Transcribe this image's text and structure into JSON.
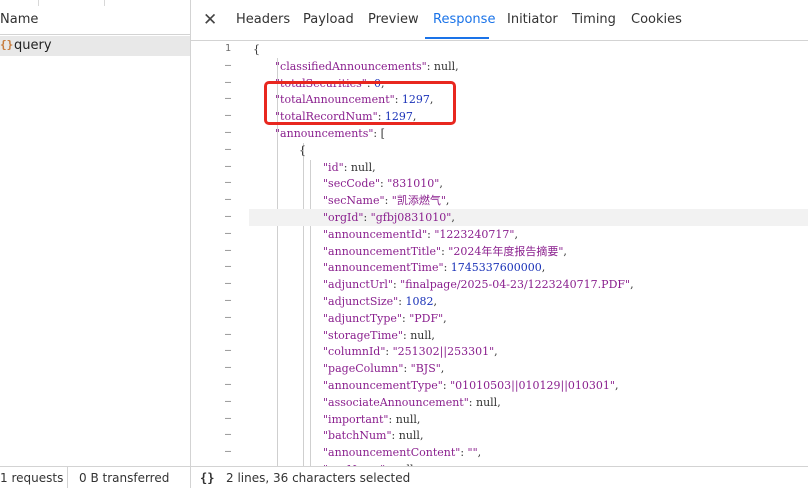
{
  "left": {
    "header": "Name",
    "request": {
      "icon": "json-braces-icon",
      "name": "query"
    }
  },
  "tabs": [
    "Headers",
    "Payload",
    "Preview",
    "Response",
    "Initiator",
    "Timing",
    "Cookies"
  ],
  "active_tab": "Response",
  "code": {
    "lines": [
      {
        "g": "1",
        "text": "{"
      },
      {
        "g": "–",
        "key": "classifiedAnnouncements",
        "val": "null",
        "vt": "p",
        "indent": 1
      },
      {
        "g": "–",
        "key": "totalSecurities",
        "val": "0",
        "vt": "n",
        "indent": 1
      },
      {
        "g": "–",
        "key": "totalAnnouncement",
        "val": "1297",
        "vt": "n",
        "indent": 1
      },
      {
        "g": "–",
        "key": "totalRecordNum",
        "val": "1297",
        "vt": "n",
        "indent": 1
      },
      {
        "g": "–",
        "key": "announcements",
        "val": "[",
        "vt": "p",
        "indent": 1,
        "noComma": true
      },
      {
        "g": "–",
        "text": "{",
        "indent": 2
      },
      {
        "g": "–",
        "key": "id",
        "val": "null",
        "vt": "p",
        "indent": 3
      },
      {
        "g": "–",
        "key": "secCode",
        "val": "\"831010\"",
        "vt": "s",
        "indent": 3
      },
      {
        "g": "–",
        "key": "secName",
        "val": "\"凯添燃气\"",
        "vt": "s",
        "indent": 3
      },
      {
        "g": "–",
        "key": "orgId",
        "val": "\"gfbj0831010\"",
        "vt": "s",
        "indent": 3,
        "hl": true
      },
      {
        "g": "–",
        "key": "announcementId",
        "val": "\"1223240717\"",
        "vt": "s",
        "indent": 3
      },
      {
        "g": "–",
        "key": "announcementTitle",
        "val": "\"2024年年度报告摘要\"",
        "vt": "s",
        "indent": 3
      },
      {
        "g": "–",
        "key": "announcementTime",
        "val": "1745337600000",
        "vt": "n",
        "indent": 3
      },
      {
        "g": "–",
        "key": "adjunctUrl",
        "val": "\"finalpage/2025-04-23/1223240717.PDF\"",
        "vt": "s",
        "indent": 3
      },
      {
        "g": "–",
        "key": "adjunctSize",
        "val": "1082",
        "vt": "n",
        "indent": 3
      },
      {
        "g": "–",
        "key": "adjunctType",
        "val": "\"PDF\"",
        "vt": "s",
        "indent": 3
      },
      {
        "g": "–",
        "key": "storageTime",
        "val": "null",
        "vt": "p",
        "indent": 3
      },
      {
        "g": "–",
        "key": "columnId",
        "val": "\"251302||253301\"",
        "vt": "s",
        "indent": 3
      },
      {
        "g": "–",
        "key": "pageColumn",
        "val": "\"BJS\"",
        "vt": "s",
        "indent": 3
      },
      {
        "g": "–",
        "key": "announcementType",
        "val": "\"01010503||010129||010301\"",
        "vt": "s",
        "indent": 3
      },
      {
        "g": "–",
        "key": "associateAnnouncement",
        "val": "null",
        "vt": "p",
        "indent": 3
      },
      {
        "g": "–",
        "key": "important",
        "val": "null",
        "vt": "p",
        "indent": 3
      },
      {
        "g": "–",
        "key": "batchNum",
        "val": "null",
        "vt": "p",
        "indent": 3
      },
      {
        "g": "–",
        "key": "announcementContent",
        "val": "\"\"",
        "vt": "s",
        "indent": 3
      },
      {
        "g": "–",
        "key": "orgName",
        "val": "null",
        "vt": "p",
        "indent": 3
      }
    ]
  },
  "status": {
    "requests": "1 requests",
    "transferred": "0 B transferred",
    "selection_icon": "braces-icon",
    "selection": "2 lines, 36 characters selected"
  }
}
